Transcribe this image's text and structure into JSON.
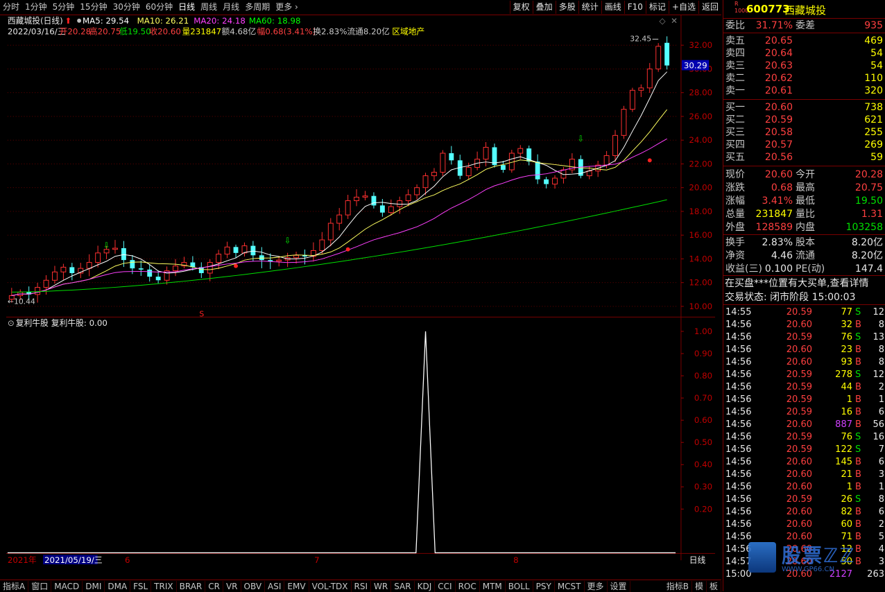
{
  "toolbar": {
    "periods": [
      "分时",
      "1分钟",
      "5分钟",
      "15分钟",
      "30分钟",
      "60分钟",
      "日线",
      "周线",
      "月线",
      "多周期",
      "更多"
    ],
    "active_period": "日线",
    "right_buttons": [
      "复权",
      "叠加",
      "多股",
      "统计",
      "画线",
      "F10",
      "标记",
      "+自选",
      "返回"
    ]
  },
  "chart": {
    "title": "西藏城投(日线)",
    "ma_legend": [
      {
        "label": "MA5: 29.54",
        "color": "#ffffff"
      },
      {
        "label": "MA10: 26.21",
        "color": "#ffff60"
      },
      {
        "label": "MA20: 24.18",
        "color": "#ff40ff"
      },
      {
        "label": "MA60: 18.98",
        "color": "#00ff00"
      }
    ],
    "info_date": "2022/03/16/三",
    "info_items": [
      {
        "label": "开20.28",
        "color": "#ff4040"
      },
      {
        "label": "高20.75",
        "color": "#ff4040"
      },
      {
        "label": "低19.50",
        "color": "#00e000"
      },
      {
        "label": "收20.60",
        "color": "#ff4040"
      },
      {
        "label": "量231847",
        "color": "#ffff00"
      },
      {
        "label": "额4.68亿",
        "color": "#c8c8c8"
      },
      {
        "label": "幅0.68(3.41%)",
        "color": "#ff4040"
      },
      {
        "label": "换2.83%",
        "color": "#c8c8c8"
      },
      {
        "label": "流通8.20亿",
        "color": "#c8c8c8"
      },
      {
        "label": "区域地产",
        "color": "#ffff00"
      }
    ],
    "price_axis": [
      "32.00",
      "30.00",
      "28.00",
      "26.00",
      "24.00",
      "22.00",
      "20.00",
      "18.00",
      "16.00",
      "14.00",
      "12.00",
      "10.00"
    ],
    "current_price_tag": "30.29",
    "high_label": "32.45",
    "low_label": "10.44",
    "indicator_title": "复利牛股",
    "indicator_value": "复利牛股: 0.00",
    "indicator_axis": [
      "1.00",
      "0.90",
      "0.80",
      "0.70",
      "0.60",
      "0.50",
      "0.40",
      "0.30",
      "0.20"
    ],
    "date_axis": [
      "2021年",
      "2021/05/19/三",
      "6",
      "7",
      "8"
    ],
    "date_mode": "日线",
    "s_marker": "S"
  },
  "chart_data": {
    "type": "line",
    "title": "西藏城投(日线)",
    "candles_close": [
      10.9,
      11.2,
      11.0,
      11.6,
      12.2,
      12.9,
      13.3,
      12.8,
      13.2,
      13.7,
      14.5,
      14.8,
      14.9,
      13.9,
      13.2,
      13.1,
      12.5,
      12.2,
      13.0,
      13.4,
      13.7,
      13.3,
      12.8,
      13.7,
      14.4,
      15.0,
      14.5,
      15.1,
      14.3,
      13.9,
      13.8,
      13.9,
      14.1,
      14.3,
      14.2,
      14.7,
      15.6,
      17.0,
      17.7,
      18.9,
      19.2,
      19.3,
      18.5,
      17.9,
      18.4,
      18.9,
      19.4,
      20.0,
      21.0,
      21.3,
      22.9,
      22.3,
      21.0,
      21.7,
      22.4,
      23.4,
      21.9,
      21.5,
      22.9,
      23.3,
      22.2,
      20.7,
      20.3,
      20.8,
      21.5,
      22.4,
      21.0,
      21.4,
      21.9,
      22.7,
      24.4,
      26.6,
      28.2,
      28.4,
      30.0,
      31.9,
      30.29
    ],
    "series": [
      {
        "name": "MA5",
        "last": 29.54
      },
      {
        "name": "MA10",
        "last": 26.21
      },
      {
        "name": "MA20",
        "last": 24.18
      },
      {
        "name": "MA60",
        "last": 18.98
      }
    ],
    "ylim": [
      9.5,
      32.8
    ],
    "indicator": {
      "name": "复利牛股",
      "ylim": [
        0,
        1.0
      ],
      "spike_index": 48,
      "spike_value": 1.0
    }
  },
  "quote": {
    "code": "600773",
    "name": "西藏城投",
    "weibi": {
      "label": "委比",
      "pct": "31.71%",
      "label2": "委差",
      "diff": "935"
    },
    "asks": [
      {
        "label": "卖五",
        "price": "20.65",
        "vol": "469"
      },
      {
        "label": "卖四",
        "price": "20.64",
        "vol": "54"
      },
      {
        "label": "卖三",
        "price": "20.63",
        "vol": "54"
      },
      {
        "label": "卖二",
        "price": "20.62",
        "vol": "110"
      },
      {
        "label": "卖一",
        "price": "20.61",
        "vol": "320"
      }
    ],
    "bids": [
      {
        "label": "买一",
        "price": "20.60",
        "vol": "738"
      },
      {
        "label": "买二",
        "price": "20.59",
        "vol": "621"
      },
      {
        "label": "买三",
        "price": "20.58",
        "vol": "255"
      },
      {
        "label": "买四",
        "price": "20.57",
        "vol": "269"
      },
      {
        "label": "买五",
        "price": "20.56",
        "vol": "59"
      }
    ],
    "stats": [
      {
        "l1": "现价",
        "v1": "20.60",
        "c1": "#ff4040",
        "l2": "今开",
        "v2": "20.28",
        "c2": "#ff4040"
      },
      {
        "l1": "涨跌",
        "v1": "0.68",
        "c1": "#ff4040",
        "l2": "最高",
        "v2": "20.75",
        "c2": "#ff4040"
      },
      {
        "l1": "涨幅",
        "v1": "3.41%",
        "c1": "#ff4040",
        "l2": "最低",
        "v2": "19.50",
        "c2": "#00e000"
      },
      {
        "l1": "总量",
        "v1": "231847",
        "c1": "#ffff00",
        "l2": "量比",
        "v2": "1.31",
        "c2": "#ff4040"
      },
      {
        "l1": "外盘",
        "v1": "128589",
        "c1": "#ff4040",
        "l2": "内盘",
        "v2": "103258",
        "c2": "#00e000"
      }
    ],
    "stats2": [
      {
        "l1": "换手",
        "v1": "2.83%",
        "l2": "股本",
        "v2": "8.20亿"
      },
      {
        "l1": "净资",
        "v1": "4.46",
        "l2": "流通",
        "v2": "8.20亿"
      },
      {
        "l1": "收益(三)",
        "v1": "0.100",
        "l2": "PE(动)",
        "v2": "147.4"
      }
    ],
    "notice": "在买盘***位置有大买单,查看详情",
    "status": "交易状态: 闭市阶段 15:00:03",
    "ticks": [
      {
        "t": "14:55",
        "p": "20.59",
        "pc": "#ff4040",
        "v": "77",
        "vc": "#ffff00",
        "s": "S",
        "n": "12"
      },
      {
        "t": "14:56",
        "p": "20.60",
        "pc": "#ff4040",
        "v": "32",
        "vc": "#ffff00",
        "s": "B",
        "n": "8"
      },
      {
        "t": "14:56",
        "p": "20.59",
        "pc": "#ff4040",
        "v": "76",
        "vc": "#ffff00",
        "s": "S",
        "n": "13"
      },
      {
        "t": "14:56",
        "p": "20.60",
        "pc": "#ff4040",
        "v": "23",
        "vc": "#ffff00",
        "s": "B",
        "n": "8"
      },
      {
        "t": "14:56",
        "p": "20.60",
        "pc": "#ff4040",
        "v": "93",
        "vc": "#ffff00",
        "s": "B",
        "n": "8"
      },
      {
        "t": "14:56",
        "p": "20.59",
        "pc": "#ff4040",
        "v": "278",
        "vc": "#ffff00",
        "s": "S",
        "n": "12"
      },
      {
        "t": "14:56",
        "p": "20.59",
        "pc": "#ff4040",
        "v": "44",
        "vc": "#ffff00",
        "s": "B",
        "n": "2"
      },
      {
        "t": "14:56",
        "p": "20.59",
        "pc": "#ff4040",
        "v": "1",
        "vc": "#ffff00",
        "s": "B",
        "n": "1"
      },
      {
        "t": "14:56",
        "p": "20.59",
        "pc": "#ff4040",
        "v": "16",
        "vc": "#ffff00",
        "s": "B",
        "n": "6"
      },
      {
        "t": "14:56",
        "p": "20.60",
        "pc": "#ff4040",
        "v": "887",
        "vc": "#d040ff",
        "s": "B",
        "n": "56"
      },
      {
        "t": "14:56",
        "p": "20.59",
        "pc": "#ff4040",
        "v": "76",
        "vc": "#ffff00",
        "s": "S",
        "n": "16"
      },
      {
        "t": "14:56",
        "p": "20.59",
        "pc": "#ff4040",
        "v": "122",
        "vc": "#ffff00",
        "s": "S",
        "n": "7"
      },
      {
        "t": "14:56",
        "p": "20.60",
        "pc": "#ff4040",
        "v": "145",
        "vc": "#ffff00",
        "s": "B",
        "n": "6"
      },
      {
        "t": "14:56",
        "p": "20.60",
        "pc": "#ff4040",
        "v": "21",
        "vc": "#ffff00",
        "s": "B",
        "n": "3"
      },
      {
        "t": "14:56",
        "p": "20.60",
        "pc": "#ff4040",
        "v": "1",
        "vc": "#ffff00",
        "s": "B",
        "n": "1"
      },
      {
        "t": "14:56",
        "p": "20.59",
        "pc": "#ff4040",
        "v": "26",
        "vc": "#ffff00",
        "s": "S",
        "n": "8"
      },
      {
        "t": "14:56",
        "p": "20.60",
        "pc": "#ff4040",
        "v": "82",
        "vc": "#ffff00",
        "s": "B",
        "n": "6"
      },
      {
        "t": "14:56",
        "p": "20.60",
        "pc": "#ff4040",
        "v": "60",
        "vc": "#ffff00",
        "s": "B",
        "n": "2"
      },
      {
        "t": "14:56",
        "p": "20.60",
        "pc": "#ff4040",
        "v": "71",
        "vc": "#ffff00",
        "s": "B",
        "n": "5"
      },
      {
        "t": "14:56",
        "p": "20.60",
        "pc": "#ff4040",
        "v": "12",
        "vc": "#ffff00",
        "s": "B",
        "n": "4"
      },
      {
        "t": "14:57",
        "p": "20.60",
        "pc": "#ff4040",
        "v": "50",
        "vc": "#ffff00",
        "s": "B",
        "n": "3"
      },
      {
        "t": "15:00",
        "p": "20.60",
        "pc": "#ff4040",
        "v": "2127",
        "vc": "#d040ff",
        "s": "",
        "n": "263"
      }
    ],
    "watermark": "股票ℤℤ",
    "watermark_sub": "WWW.GP66.CN"
  },
  "bottombar": [
    "指标A",
    "窗口",
    "MACD",
    "DMI",
    "DMA",
    "FSL",
    "TRIX",
    "BRAR",
    "CR",
    "VR",
    "OBV",
    "ASI",
    "EMV",
    "VOL-TDX",
    "RSI",
    "WR",
    "SAR",
    "KDJ",
    "CCI",
    "ROC",
    "MTM",
    "BOLL",
    "PSY",
    "MCST",
    "更多",
    "设置"
  ],
  "bottombar_right": [
    "指标B",
    "模",
    "板"
  ]
}
